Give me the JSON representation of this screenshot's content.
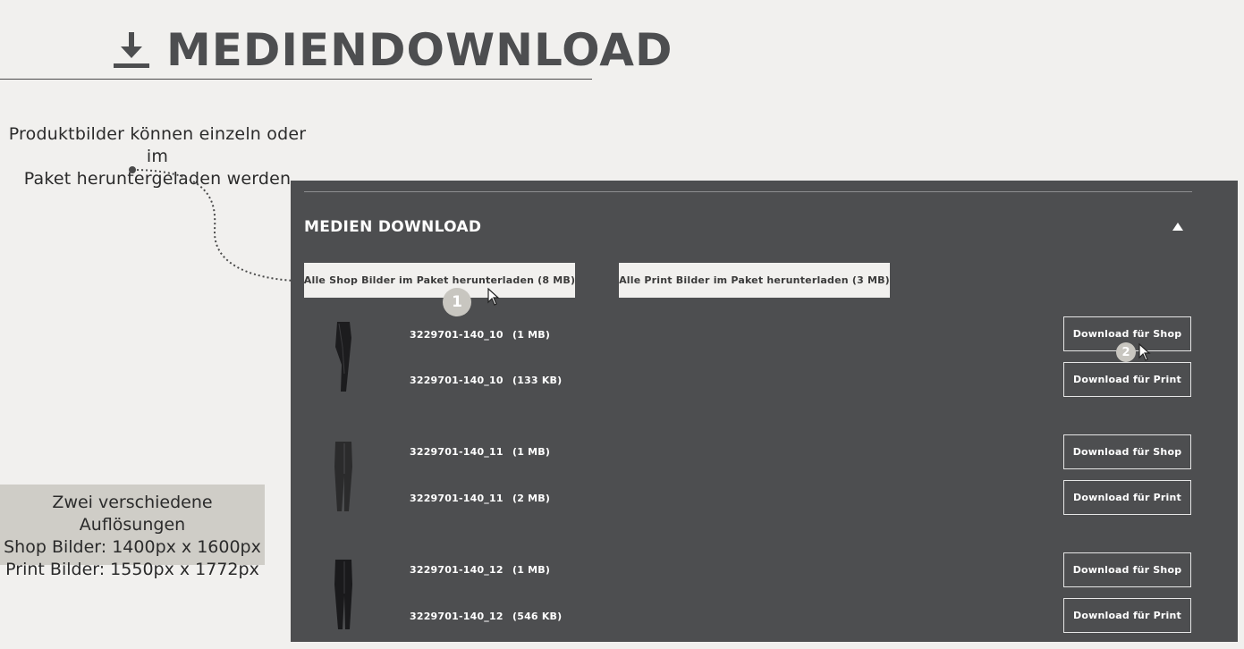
{
  "header": {
    "title": "MEDIENDOWNLOAD",
    "icon": "download-icon"
  },
  "annotations": {
    "package_note": [
      "Produktbilder können einzeln oder im",
      "Paket heruntergeladen werden"
    ],
    "resolution_note": [
      "Zwei verschiedene Auflösungen",
      "Shop Bilder: 1400px x 1600px",
      "Print Bilder: 1550px x 1772px"
    ]
  },
  "panel": {
    "title": "MEDIEN DOWNLOAD",
    "collapse_icon": "chevron-up-icon",
    "package_buttons": {
      "shop": "Alle Shop Bilder im Paket herunterladen (8 MB)",
      "print": "Alle Print Bilder im Paket herunterladen (3 MB)"
    },
    "step_badges": [
      "1",
      "2"
    ],
    "products": [
      {
        "thumbnail": "jeans-thumbnail",
        "rows": [
          {
            "code": "3229701-140_10",
            "size": "(1 MB)",
            "button": "Download für Shop"
          },
          {
            "code": "3229701-140_10",
            "size": "(133 KB)",
            "button": "Download für Print"
          }
        ]
      },
      {
        "thumbnail": "jeans-thumbnail",
        "rows": [
          {
            "code": "3229701-140_11",
            "size": "(1 MB)",
            "button": "Download für Shop"
          },
          {
            "code": "3229701-140_11",
            "size": "(2 MB)",
            "button": "Download für Print"
          }
        ]
      },
      {
        "thumbnail": "jeans-thumbnail",
        "rows": [
          {
            "code": "3229701-140_12",
            "size": "(1 MB)",
            "button": "Download für Shop"
          },
          {
            "code": "3229701-140_12",
            "size": "(546 KB)",
            "button": "Download für Print"
          }
        ]
      }
    ]
  },
  "colors": {
    "page_bg": "#f1f0ee",
    "panel_bg": "#4d4e50",
    "title": "#4d4e50",
    "badge": "#c8c6c0",
    "note_box": "#cfcdc7"
  }
}
